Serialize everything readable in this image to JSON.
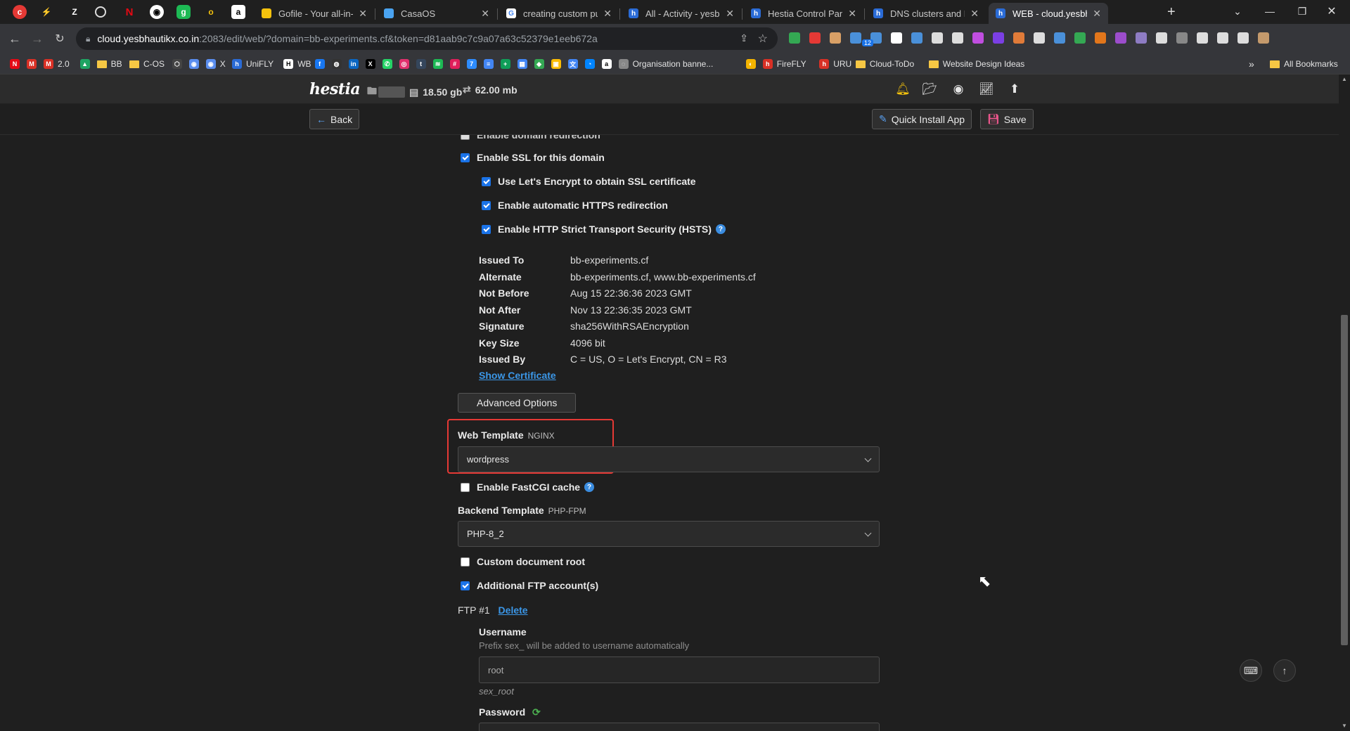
{
  "browser": {
    "tabs": [
      {
        "title": "Gofile - Your all-in-one",
        "favicon_color": "#f4c20d",
        "favicon_text": ""
      },
      {
        "title": "CasaOS",
        "favicon_color": "#4aa3f0",
        "favicon_text": ""
      },
      {
        "title": "creating custom public",
        "favicon_color": "#ffffff",
        "favicon_text": "G"
      },
      {
        "title": "All - Activity - yesbhau",
        "favicon_color": "#2a6bd6",
        "favicon_text": "h"
      },
      {
        "title": "Hestia Control Panel - ",
        "favicon_color": "#2a6bd6",
        "favicon_text": "h"
      },
      {
        "title": "DNS clusters and DNS",
        "favicon_color": "#2a6bd6",
        "favicon_text": "h"
      },
      {
        "title": "WEB - cloud.yesbhaut",
        "favicon_color": "#2a6bd6",
        "favicon_text": "h"
      }
    ],
    "new_tab": "+",
    "url_host": "cloud.yesbhautikx.co.in",
    "url_path": ":2083/edit/web/?domain=bb-experiments.cf&token=d81aab9c7c9a07a63c52379e1eeb672a",
    "extension_badge": "12",
    "bookmarks": [
      {
        "label": "",
        "color": "#e50914",
        "text": "N"
      },
      {
        "label": "",
        "color": "#d93025",
        "text": "M"
      },
      {
        "label": "2.0",
        "color": "#d93025",
        "text": "M"
      },
      {
        "label": "",
        "color": "#1fa463",
        "text": "▲"
      },
      {
        "label": "BB",
        "folder": true
      },
      {
        "label": "C-OS",
        "folder": true
      },
      {
        "label": "",
        "color": "#444",
        "text": "⬡"
      },
      {
        "label": "",
        "color": "#5a8dee",
        "text": "◉"
      },
      {
        "label": "X",
        "color": "#5a8dee",
        "text": "◉"
      },
      {
        "label": "UniFLY",
        "color": "#2a6bd6",
        "text": "h"
      },
      {
        "label": "WB",
        "color": "#ffffff",
        "text": "H"
      },
      {
        "label": "",
        "color": "#1877f2",
        "text": "f"
      },
      {
        "label": "",
        "color": "#333",
        "text": "◍"
      },
      {
        "label": "",
        "color": "#0a66c2",
        "text": "in"
      },
      {
        "label": "",
        "color": "#000",
        "text": "X"
      },
      {
        "label": "",
        "color": "#25d366",
        "text": "✆"
      },
      {
        "label": "",
        "color": "#e1306c",
        "text": "◎"
      },
      {
        "label": "",
        "color": "#35465c",
        "text": "t"
      },
      {
        "label": "",
        "color": "#1db954",
        "text": "≋"
      },
      {
        "label": "",
        "color": "#e01e5a",
        "text": "#"
      },
      {
        "label": "",
        "color": "#2d8cff",
        "text": "7"
      },
      {
        "label": "",
        "color": "#4285f4",
        "text": "≡"
      },
      {
        "label": "",
        "color": "#0f9d58",
        "text": "+"
      },
      {
        "label": "",
        "color": "#4285f4",
        "text": "▦"
      },
      {
        "label": "",
        "color": "#34a853",
        "text": "◆"
      },
      {
        "label": "",
        "color": "#fbbc04",
        "text": "▣"
      },
      {
        "label": "",
        "color": "#4285f4",
        "text": "文"
      },
      {
        "label": "",
        "color": "#0084ff",
        "text": "◔"
      },
      {
        "label": "",
        "color": "#fff",
        "text": "a"
      },
      {
        "label": "Organisation banne...",
        "color": "#888",
        "text": "◌"
      },
      {
        "label": "",
        "color": "#f4b400",
        "text": "◐"
      },
      {
        "label": "FireFLY",
        "color": "#d93025",
        "text": "h"
      },
      {
        "label": "URU",
        "color": "#d93025",
        "text": "h"
      },
      {
        "label": "Cloud-ToDo",
        "folder": true
      },
      {
        "label": "Website Design Ideas",
        "folder": true
      }
    ],
    "bookmarks_overflow": "»",
    "all_bookmarks": "All Bookmarks"
  },
  "hestia": {
    "logo": "hestia",
    "disk_usage": "18.50 gb",
    "bandwidth": "62.00 mb",
    "back_label": "Back",
    "quick_install_label": "Quick Install App",
    "save_label": "Save"
  },
  "form": {
    "partial_top_option": "Enable domain redirection",
    "ssl_enable": {
      "label": "Enable SSL for this domain",
      "checked": true
    },
    "letsencrypt": {
      "label": "Use Let's Encrypt to obtain SSL certificate",
      "checked": true
    },
    "https_redirect": {
      "label": "Enable automatic HTTPS redirection",
      "checked": true
    },
    "hsts": {
      "label": "Enable HTTP Strict Transport Security (HSTS)",
      "checked": true
    },
    "certificate": [
      {
        "key": "Issued To",
        "value": "bb-experiments.cf"
      },
      {
        "key": "Alternate",
        "value": "bb-experiments.cf, www.bb-experiments.cf"
      },
      {
        "key": "Not Before",
        "value": "Aug 15 22:36:36 2023 GMT"
      },
      {
        "key": "Not After",
        "value": "Nov 13 22:36:35 2023 GMT"
      },
      {
        "key": "Signature",
        "value": "sha256WithRSAEncryption"
      },
      {
        "key": "Key Size",
        "value": "4096 bit"
      },
      {
        "key": "Issued By",
        "value": "C = US, O = Let's Encrypt, CN = R3"
      }
    ],
    "show_certificate": "Show Certificate",
    "advanced_options": "Advanced Options",
    "web_template": {
      "label": "Web Template",
      "sub": "NGINX",
      "value": "wordpress"
    },
    "fastcgi": {
      "label": "Enable FastCGI cache",
      "checked": false
    },
    "backend_template": {
      "label": "Backend Template",
      "sub": "PHP-FPM",
      "value": "PHP-8_2"
    },
    "custom_docroot": {
      "label": "Custom document root",
      "checked": false
    },
    "additional_ftp": {
      "label": "Additional FTP account(s)",
      "checked": true
    },
    "ftp_heading": "FTP #1",
    "ftp_delete": "Delete",
    "username_label": "Username",
    "username_hint": "Prefix sex_ will be added to username automatically",
    "username_value": "root",
    "username_preview": "sex_root",
    "password_label": "Password"
  },
  "highlight_color": "#e53935"
}
